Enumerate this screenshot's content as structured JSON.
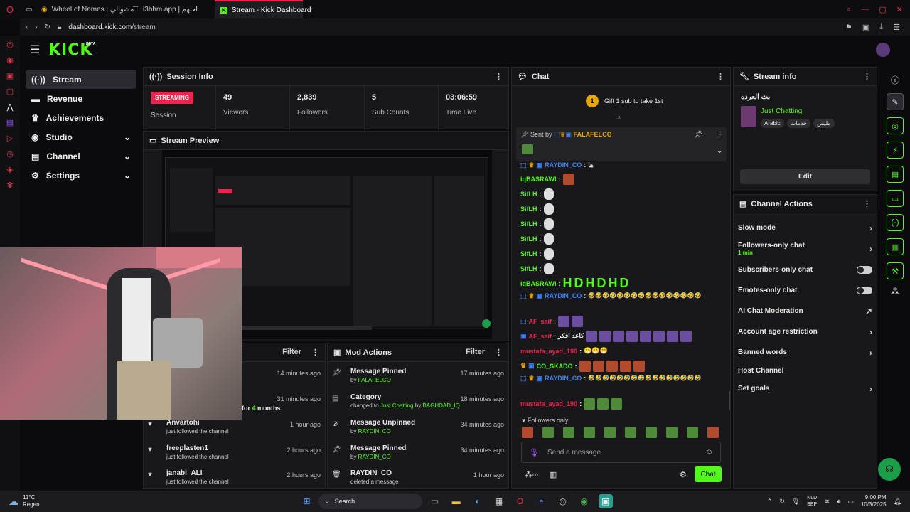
{
  "browser": {
    "tabs": [
      {
        "label": "Wheel of Names | مشوالي"
      },
      {
        "label": "l3bhm.app | لعبهم"
      },
      {
        "label": "Stream - Kick Dashboard"
      }
    ],
    "url_host": "dashboard.kick.com",
    "url_path": "/stream"
  },
  "header": {
    "logo": "KICK",
    "beta": "BETA"
  },
  "nav": {
    "items": [
      {
        "label": "Stream",
        "icon": "broadcast-icon"
      },
      {
        "label": "Revenue",
        "icon": "money-icon"
      },
      {
        "label": "Achievements",
        "icon": "trophy-icon"
      },
      {
        "label": "Studio",
        "icon": "studio-icon"
      },
      {
        "label": "Channel",
        "icon": "channel-icon"
      },
      {
        "label": "Settings",
        "icon": "gear-icon"
      }
    ]
  },
  "session": {
    "title": "Session Info",
    "status": "STREAMING",
    "status_label": "Session",
    "stats": [
      {
        "value": "49",
        "label": "Viewers"
      },
      {
        "value": "2,839",
        "label": "Followers"
      },
      {
        "value": "5",
        "label": "Sub Counts"
      },
      {
        "value": "03:06:59",
        "label": "Time Live"
      }
    ]
  },
  "preview": {
    "title": "Stream Preview"
  },
  "activity": {
    "filter": "Filter",
    "items": [
      {
        "time": "14 minutes ago"
      },
      {
        "time": "31 minutes ago",
        "text_a": "for ",
        "months": "4",
        "text_b": " months"
      },
      {
        "name": "Anvartohi",
        "sub": "just followed the channel",
        "time": "1 hour ago"
      },
      {
        "name": "freeplasten1",
        "sub": "just followed the channel",
        "time": "2 hours ago"
      },
      {
        "name": "janabi_ALI",
        "sub": "just followed the channel",
        "time": "2 hours ago"
      }
    ]
  },
  "mod_actions": {
    "title": "Mod Actions",
    "filter": "Filter",
    "items": [
      {
        "title": "Message Pinned",
        "by": "by ",
        "user": "FALAFELCO",
        "time": "17 minutes ago"
      },
      {
        "title": "Category",
        "sub_a": "changed to ",
        "cat": "Just Chatting",
        "sub_b": " by ",
        "user": "BAGHDAD_IQ",
        "time": "18 minutes ago"
      },
      {
        "title": "Message Unpinned",
        "by": "by ",
        "user": "RAYDIN_CO",
        "time": "34 minutes ago"
      },
      {
        "title": "Message Pinned",
        "by": "by ",
        "user": "RAYDIN_CO",
        "time": "34 minutes ago"
      },
      {
        "title": "RAYDIN_CO",
        "sub": "deleted a message",
        "time": "1 hour ago"
      }
    ]
  },
  "chat": {
    "title": "Chat",
    "gift_count": "1",
    "gift_text": "Gift 1 sub to take 1st",
    "pinned_label": "Sent by",
    "pinned_user": "FALAFELCO",
    "messages": [
      {
        "user": "RAYDIN_CO",
        "color": "#3b82f6",
        "text": "ها"
      },
      {
        "user": "iqBASRAWI",
        "color": "#53fc18",
        "text": ""
      },
      {
        "user": "SifLH",
        "color": "#53fc18",
        "text": ""
      },
      {
        "user": "SifLH",
        "color": "#53fc18",
        "text": ""
      },
      {
        "user": "SifLH",
        "color": "#53fc18",
        "text": ""
      },
      {
        "user": "SifLH",
        "color": "#53fc18",
        "text": ""
      },
      {
        "user": "SifLH",
        "color": "#53fc18",
        "text": ""
      },
      {
        "user": "SifLH",
        "color": "#53fc18",
        "text": ""
      },
      {
        "user": "iqBASRAWI",
        "color": "#53fc18",
        "text": "HDHDHD"
      },
      {
        "user": "RAYDIN_CO",
        "color": "#3b82f6",
        "text": "🤣🤣🤣🤣🤣🤣🤣🤣🤣🤣🤣🤣🤣🤣🤣🤣"
      },
      {
        "user": "AF_saif",
        "color": "#e9264d",
        "text": ""
      },
      {
        "user": "AF_saif",
        "color": "#e9264d",
        "text": "كاعد افكر"
      },
      {
        "user": "mustafa_ayad_190",
        "color": "#e9264d",
        "text": "😁😁😁"
      },
      {
        "user": "CO_SKADO",
        "color": "#53fc18",
        "text": ""
      },
      {
        "user": "RAYDIN_CO",
        "color": "#3b82f6",
        "text": "🤣🤣🤣🤣🤣🤣🤣🤣🤣🤣🤣🤣🤣🤣🤣🤣"
      },
      {
        "user": "mustafa_ayad_190",
        "color": "#e9264d",
        "text": ""
      }
    ],
    "followers_only": "Followers only",
    "placeholder": "Send a message",
    "send": "Chat"
  },
  "stream_info": {
    "title": "Stream info",
    "stream_title": "بث العرده",
    "category": "Just Chatting",
    "tags": [
      "Arabic",
      "خدمات",
      "مليس"
    ],
    "edit": "Edit"
  },
  "channel_actions": {
    "title": "Channel Actions",
    "items": [
      {
        "label": "Slow mode",
        "control": "chevron"
      },
      {
        "label": "Followers-only chat",
        "sub": "1 min",
        "control": "chevron"
      },
      {
        "label": "Subscribers-only chat",
        "control": "toggle"
      },
      {
        "label": "Emotes-only chat",
        "control": "toggle"
      },
      {
        "label": "AI Chat Moderation",
        "control": "external"
      },
      {
        "label": "Account age restriction",
        "control": "chevron"
      },
      {
        "label": "Banned words",
        "control": "chevron"
      },
      {
        "label": "Host Channel",
        "control": "none"
      },
      {
        "label": "Set goals",
        "control": "chevron"
      }
    ]
  },
  "taskbar": {
    "temp": "11°C",
    "weather": "Regen",
    "search": "Search",
    "lang_a": "NLD",
    "lang_b": "BEP",
    "time": "9:00 PM",
    "date": "10/3/2025"
  },
  "colors": {
    "accent": "#53fc18",
    "live": "#e9264d",
    "panel": "#18181b",
    "bg": "#0b0b0e"
  }
}
